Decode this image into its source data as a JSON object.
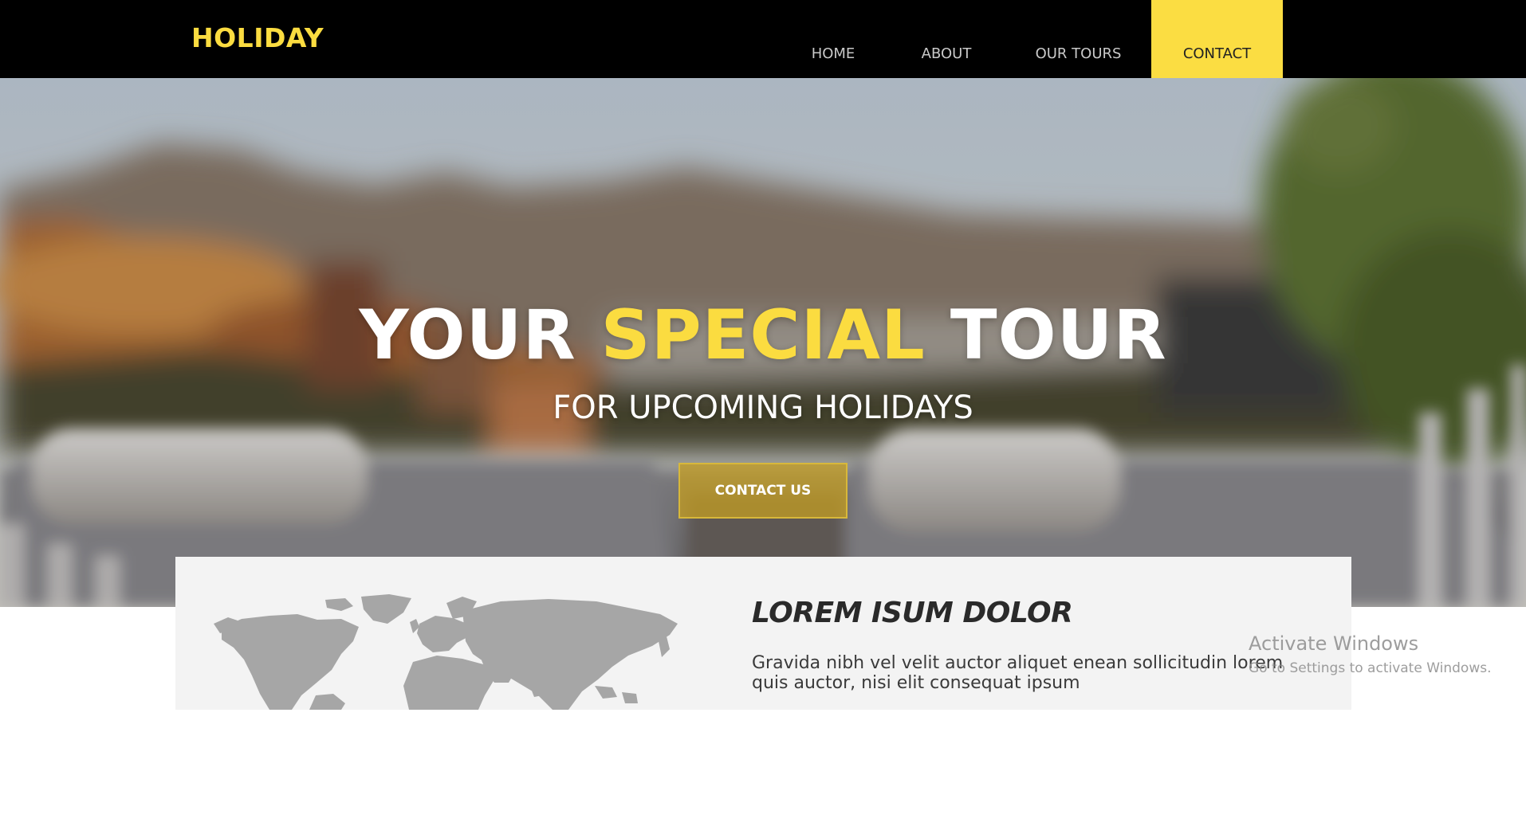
{
  "brand": {
    "logo_text": "HOLIDAY"
  },
  "nav": {
    "items": [
      {
        "label": "HOME"
      },
      {
        "label": "ABOUT"
      },
      {
        "label": "OUR TOURS"
      },
      {
        "label": "CONTACT",
        "active": true
      }
    ]
  },
  "hero": {
    "title_part1": "YOUR",
    "title_accent": "SPECIAL",
    "title_part2": "TOUR",
    "subtitle": "FOR UPCOMING HOLIDAYS",
    "cta_label": "CONTACT US"
  },
  "feature": {
    "title": "LOREM ISUM DOLOR",
    "body": "Gravida nibh vel velit auctor aliquet enean sollicitudin lorem quis auctor, nisi elit consequat ipsum"
  },
  "watermark": {
    "title": "Activate Windows",
    "subtitle": "Go to Settings to activate Windows."
  },
  "colors": {
    "accent": "#fbdc40",
    "nav_background": "#000000",
    "nav_active": "#fbdd42",
    "feature_background": "#f3f3f3",
    "map_gray": "#a6a6a6"
  }
}
